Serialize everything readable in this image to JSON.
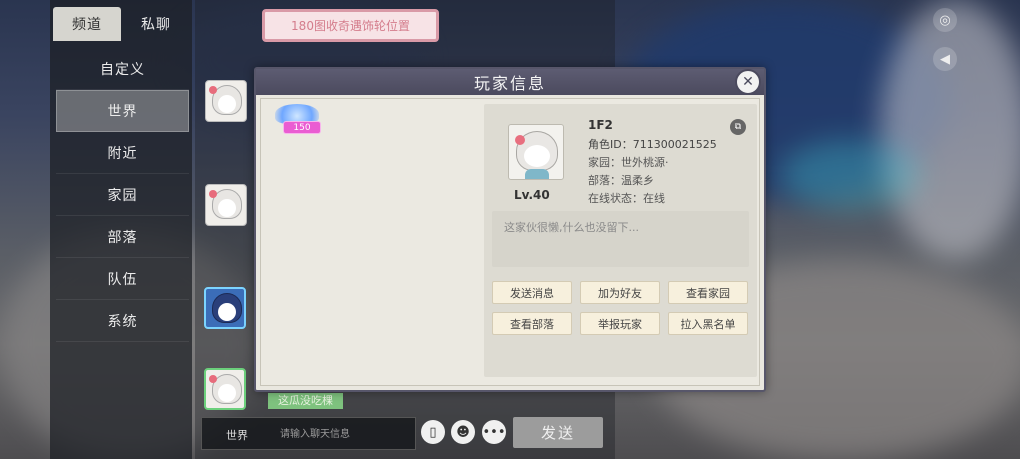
{
  "tabs": {
    "channel": "频道",
    "private": "私聊"
  },
  "channels": [
    "自定义",
    "世界",
    "附近",
    "家园",
    "部落",
    "队伍",
    "系统"
  ],
  "active_channel_index": 1,
  "banner": {
    "text": "180图收奇遇饰轮位置"
  },
  "chat": {
    "message_preview": "这瓜没吃棵",
    "input_channel": "世界",
    "input_placeholder": "请输入聊天信息",
    "send_label": "发送"
  },
  "modal": {
    "title": "玩家信息",
    "close_icon": "close-icon",
    "level_badge": "150",
    "player": {
      "name": "1F2",
      "level": "Lv.40",
      "role_id": "角色ID：711300021525",
      "home": "家园：世外桃源·",
      "tribe": "部落：温柔乡",
      "status": "在线状态：在线",
      "signature": "这家伙很懒,什么也没留下..."
    },
    "actions": [
      "发送消息",
      "加为好友",
      "查看家园",
      "查看部落",
      "举报玩家",
      "拉入黑名单"
    ]
  },
  "icons": {
    "top_right": "camera-icon",
    "second_right": "megaphone-icon",
    "round_buttons": [
      "voice-icon",
      "emoji-icon",
      "more-icon"
    ]
  }
}
